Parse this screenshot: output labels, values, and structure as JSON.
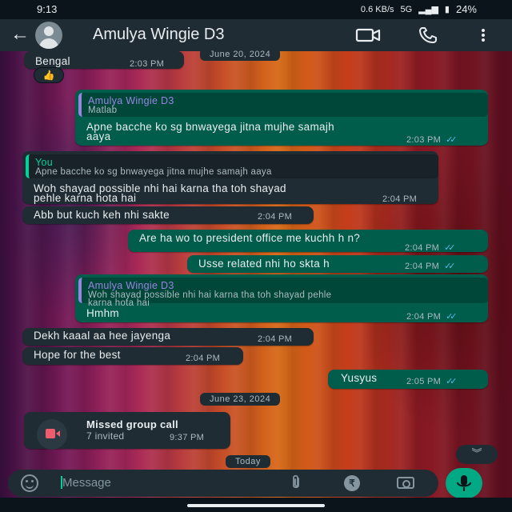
{
  "status_bar": {
    "time": "9:13",
    "net_speed": "0.6 KB/s",
    "network": "5G",
    "battery": "24%"
  },
  "header": {
    "contact_name": "Amulya Wingie D3",
    "icons": [
      "back-arrow-icon",
      "avatar-icon",
      "video-call-icon",
      "voice-call-icon",
      "more-options-icon"
    ]
  },
  "messages": [
    {
      "type": "incoming",
      "text": "Bengal",
      "time": "2:03 PM",
      "reaction": "👍"
    },
    {
      "type": "outgoing",
      "quote": {
        "name": "Amulya Wingie D3",
        "text": "Matlab"
      },
      "text_lines": [
        "Apne bacche ko sg bnwayega jitna mujhe samajh",
        "aaya"
      ],
      "time": "2:03 PM"
    },
    {
      "type": "incoming",
      "quote": {
        "name": "You",
        "text": "Apne bacche ko sg bnwayega jitna mujhe samajh aaya"
      },
      "text_lines": [
        "Woh shayad possible nhi hai karna tha toh shayad",
        "pehle karna hota hai"
      ],
      "time": "2:04 PM"
    },
    {
      "type": "incoming",
      "text": "Abb but kuch keh nhi sakte",
      "time": "2:04 PM"
    },
    {
      "type": "outgoing",
      "text": "Are ha wo to president office me kuchh h n?",
      "time": "2:04 PM"
    },
    {
      "type": "outgoing",
      "text": "Usse related nhi ho skta h",
      "time": "2:04 PM"
    },
    {
      "type": "outgoing",
      "quote": {
        "name": "Amulya Wingie D3",
        "text_lines": [
          "Woh shayad possible nhi hai karna tha toh shayad pehle",
          "karna hota hai"
        ]
      },
      "text": "Hmhm",
      "time": "2:04 PM"
    },
    {
      "type": "incoming",
      "text": "Dekh kaaal aa hee jayenga",
      "time": "2:04 PM"
    },
    {
      "type": "incoming",
      "text": "Hope for the best",
      "time": "2:04 PM"
    },
    {
      "type": "outgoing",
      "text": "Yusyus",
      "time": "2:05 PM"
    }
  ],
  "dates": {
    "top_partial": "June 20, 2024",
    "middle": "June 23, 2024",
    "bottom": "Today"
  },
  "call": {
    "title": "Missed group call",
    "subtitle": "7 invited",
    "time": "9:37 PM"
  },
  "input": {
    "placeholder": "Message"
  },
  "colors": {
    "incoming_bubble": "#1f2c34",
    "outgoing_bubble": "#005c4b",
    "read_ticks": "#53bdeb",
    "accent_green": "#00a884"
  }
}
